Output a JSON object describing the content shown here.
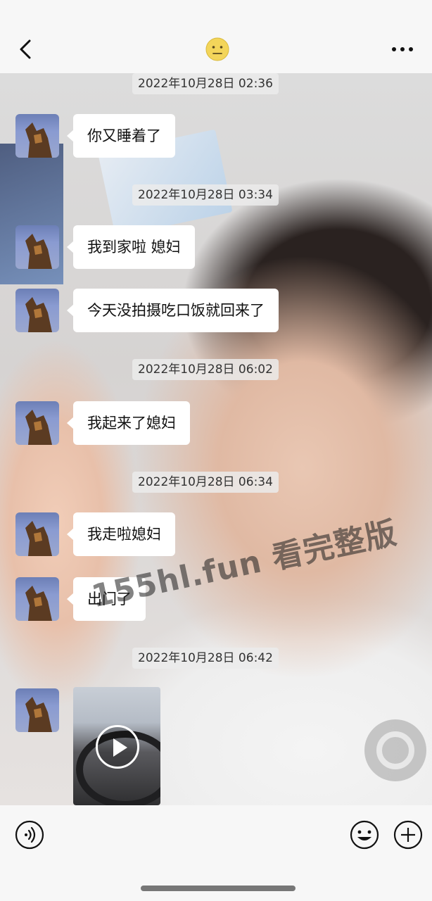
{
  "header": {
    "back_icon": "chevron-left-icon",
    "contact_icon": "smiley-emoji-icon",
    "more_icon": "ellipsis-icon"
  },
  "messages": [
    {
      "type": "timestamp",
      "text": "2022年10月28日 02:36"
    },
    {
      "type": "text",
      "text": "你又睡着了"
    },
    {
      "type": "timestamp",
      "text": "2022年10月28日 03:34"
    },
    {
      "type": "text",
      "text": "我到家啦 媳妇"
    },
    {
      "type": "text",
      "text": "今天没拍摄吃口饭就回来了"
    },
    {
      "type": "timestamp",
      "text": "2022年10月28日 06:02"
    },
    {
      "type": "text",
      "text": "我起来了媳妇"
    },
    {
      "type": "timestamp",
      "text": "2022年10月28日 06:34"
    },
    {
      "type": "text",
      "text": "我走啦媳妇"
    },
    {
      "type": "text",
      "text": "出门了"
    },
    {
      "type": "timestamp",
      "text": "2022年10月28日 06:42"
    },
    {
      "type": "video",
      "icon": "play-icon"
    }
  ],
  "watermark": "155hl.fun 看完整版",
  "bottom_bar": {
    "voice_icon": "voice-icon",
    "emoji_icon": "emoji-icon",
    "add_icon": "plus-icon"
  },
  "colors": {
    "bubble": "#ffffff",
    "header_bg": "#f7f7f7",
    "timestamp_bg": "#ebebeb"
  }
}
